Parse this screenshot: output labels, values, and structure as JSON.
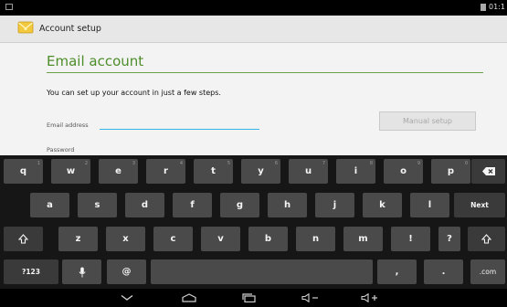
{
  "status_bar": {
    "time": "01:1"
  },
  "app_bar": {
    "title": "Account setup"
  },
  "form": {
    "heading": "Email account",
    "intro": "You can set up your account in just a few steps.",
    "email_label": "Email address",
    "email_value": "",
    "manual_setup_label": "Manual setup",
    "password_label": "Password"
  },
  "keyboard": {
    "row1": [
      {
        "label": "q",
        "hint": "1"
      },
      {
        "label": "w",
        "hint": "2"
      },
      {
        "label": "e",
        "hint": "3"
      },
      {
        "label": "r",
        "hint": "4"
      },
      {
        "label": "t",
        "hint": "5"
      },
      {
        "label": "y",
        "hint": "6"
      },
      {
        "label": "u",
        "hint": "7"
      },
      {
        "label": "i",
        "hint": "8"
      },
      {
        "label": "o",
        "hint": "9"
      },
      {
        "label": "p",
        "hint": "0"
      }
    ],
    "row2": [
      {
        "label": "a"
      },
      {
        "label": "s"
      },
      {
        "label": "d"
      },
      {
        "label": "f"
      },
      {
        "label": "g"
      },
      {
        "label": "h"
      },
      {
        "label": "j"
      },
      {
        "label": "k"
      },
      {
        "label": "l"
      }
    ],
    "row3": [
      {
        "label": "z"
      },
      {
        "label": "x"
      },
      {
        "label": "c"
      },
      {
        "label": "v"
      },
      {
        "label": "b"
      },
      {
        "label": "n"
      },
      {
        "label": "m"
      },
      {
        "label": "!"
      },
      {
        "label": "?"
      }
    ],
    "symbols_label": "?123",
    "at_label": "@",
    "comma_label": ",",
    "period_label": ".",
    "dotcom_label": ".com",
    "next_label": "Next"
  }
}
